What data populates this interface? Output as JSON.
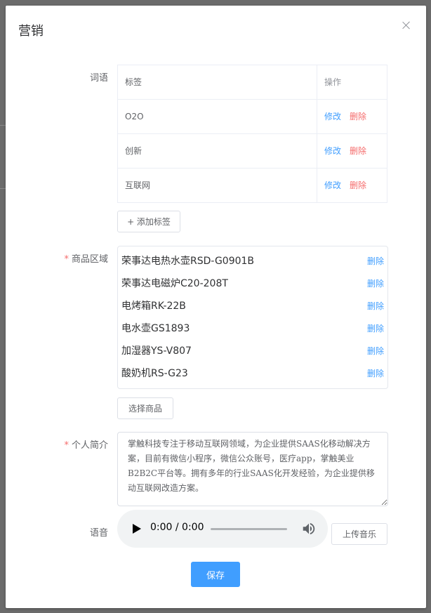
{
  "dialog": {
    "title": "营销"
  },
  "words": {
    "label": "词语",
    "table": {
      "header_tag": "标签",
      "header_op": "操作",
      "rows": [
        {
          "tag": "O2O",
          "edit": "修改",
          "delete": "删除"
        },
        {
          "tag": "创新",
          "edit": "修改",
          "delete": "删除"
        },
        {
          "tag": "互联网",
          "edit": "修改",
          "delete": "删除"
        }
      ]
    },
    "add_button": "+ 添加标签"
  },
  "products": {
    "required_mark": "*",
    "label": "商品区域",
    "items": [
      {
        "name": "荣事达电热水壶RSD-G0901B",
        "delete": "删除"
      },
      {
        "name": "荣事达电磁炉C20-208T",
        "delete": "删除"
      },
      {
        "name": "电烤箱RK-22B",
        "delete": "删除"
      },
      {
        "name": "电水壶GS1893",
        "delete": "删除"
      },
      {
        "name": "加湿器YS-V807",
        "delete": "删除"
      },
      {
        "name": "酸奶机RS-G23",
        "delete": "删除"
      }
    ],
    "select_button": "选择商品"
  },
  "intro": {
    "required_mark": "*",
    "label": "个人简介",
    "value": "掌触科技专注于移动互联网领域，为企业提供SAAS化移动解决方案，目前有微信小程序，微信公众账号，医疗app，掌触美业B2B2C平台等。拥有多年的行业SAAS化开发经验，为企业提供移动互联网改造方案。"
  },
  "voice": {
    "label": "语音",
    "time": "0:00 / 0:00",
    "upload_button": "上传音乐"
  },
  "save_button": "保存",
  "colors": {
    "primary": "#409eff",
    "danger": "#f56c6c"
  }
}
